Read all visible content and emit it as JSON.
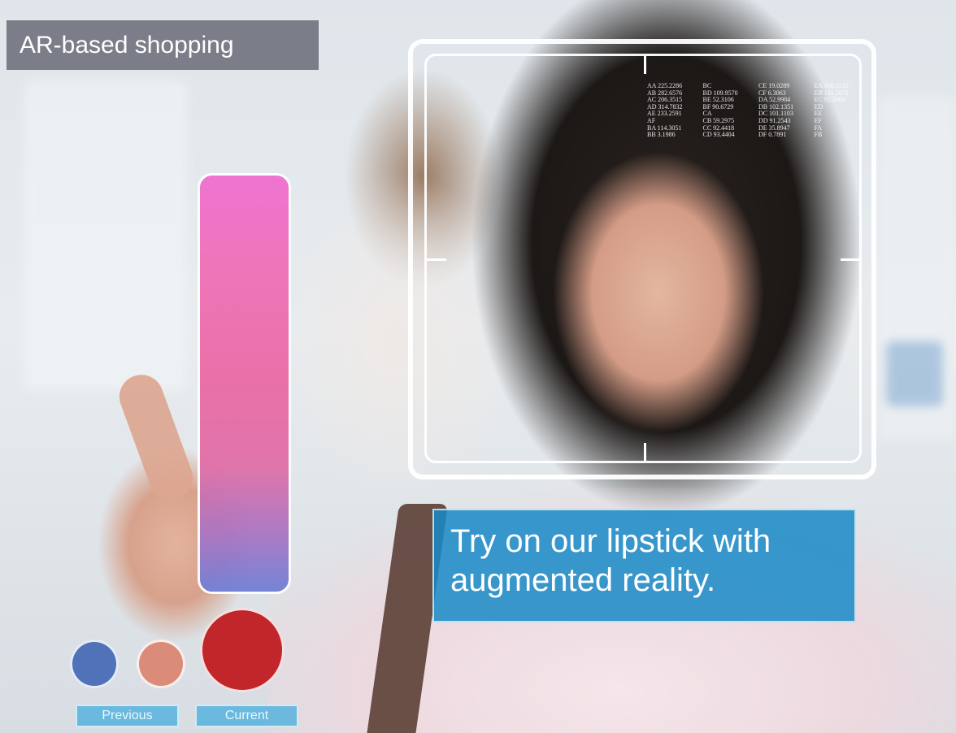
{
  "header": {
    "title": "AR-based shopping"
  },
  "overlay": {
    "caption_line1": "Try on our lipstick with",
    "caption_line2": "augmented reality.",
    "readout": [
      "AA 225.2286",
      "BC",
      "CE 19.0289",
      "EA 108.3510",
      "AB 282.6576",
      "BD 109.9570",
      "CF 6.3063",
      "EB 121.5072",
      "AC 206.3515",
      "BE 52.3106",
      "DA 52.9984",
      "EC 92.5004",
      "AD 314.7832",
      "BF 90.6729",
      "DB 102.1351",
      "ED",
      "AE 233.2591",
      "CA",
      "DC 101.1103",
      "EE",
      "AF",
      "CB 59.2975",
      "DD 91.2543",
      "EF",
      "BA 114.3051",
      "CC 92.4418",
      "DE 35.8947",
      "FA",
      "BB 3.1986",
      "CD 93.4404",
      "DF 0.7891",
      "FB"
    ]
  },
  "lipstick": {
    "selector_colors": [
      "#f06ed0",
      "#ea6aa4",
      "#6f80d6"
    ],
    "swatches": [
      {
        "color": "#4f72b8"
      },
      {
        "color": "#db8c78"
      },
      {
        "color": "#c0262a"
      }
    ],
    "previous_label": "Previous",
    "current_label": "Current"
  }
}
